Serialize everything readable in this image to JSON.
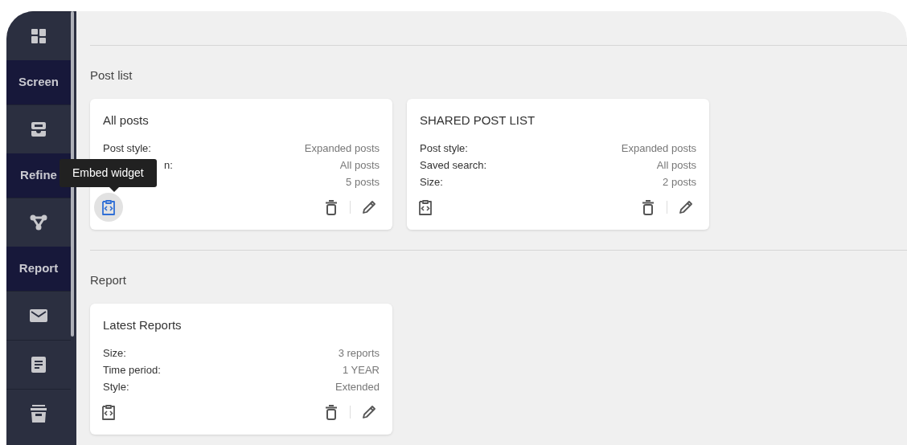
{
  "sidebar": {
    "items": [
      {
        "kind": "icon"
      },
      {
        "kind": "label",
        "text": "Screen"
      },
      {
        "kind": "icon"
      },
      {
        "kind": "label",
        "text": "Refine"
      },
      {
        "kind": "icon"
      },
      {
        "kind": "label",
        "text": "Report"
      },
      {
        "kind": "icon"
      },
      {
        "kind": "icon"
      },
      {
        "kind": "icon"
      }
    ]
  },
  "sections": [
    {
      "title": "Post list",
      "cards": [
        {
          "title": "All posts",
          "rows": [
            {
              "label": "Post style:",
              "value": "Expanded posts",
              "partly_hidden": false
            },
            {
              "label": "n:",
              "value": "All posts",
              "partly_hidden": true
            },
            {
              "value": "5 posts"
            }
          ],
          "embed_active": true,
          "tooltip": "Embed widget"
        },
        {
          "title": "SHARED POST LIST",
          "rows": [
            {
              "label": "Post style:",
              "value": "Expanded posts",
              "partly_hidden": false
            },
            {
              "label": "Saved search:",
              "value": "All posts",
              "partly_hidden": false
            },
            {
              "label": "Size:",
              "value": "2 posts",
              "partly_hidden": false
            }
          ],
          "embed_active": false
        }
      ]
    },
    {
      "title": "Report",
      "cards": [
        {
          "title": "Latest Reports",
          "rows": [
            {
              "label": "Size:",
              "value": "3 reports",
              "partly_hidden": false
            },
            {
              "label": "Time period:",
              "value": "1 YEAR",
              "partly_hidden": false
            },
            {
              "label": "Style:",
              "value": "Extended",
              "partly_hidden": false
            }
          ],
          "embed_active": false
        }
      ]
    }
  ]
}
